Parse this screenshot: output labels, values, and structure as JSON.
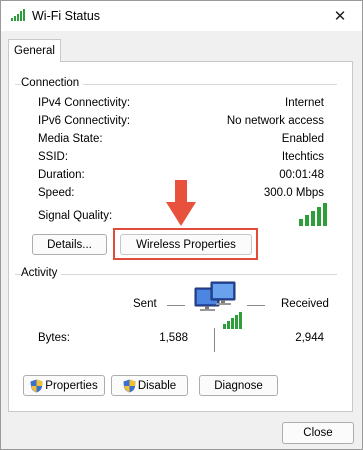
{
  "window": {
    "title": "Wi-Fi Status",
    "close_glyph": "✕"
  },
  "tabs": [
    {
      "label": "General"
    }
  ],
  "connection": {
    "heading": "Connection",
    "rows": [
      {
        "label": "IPv4 Connectivity:",
        "value": "Internet"
      },
      {
        "label": "IPv6 Connectivity:",
        "value": "No network access"
      },
      {
        "label": "Media State:",
        "value": "Enabled"
      },
      {
        "label": "SSID:",
        "value": "Itechtics"
      },
      {
        "label": "Duration:",
        "value": "00:01:48"
      },
      {
        "label": "Speed:",
        "value": "300.0 Mbps"
      }
    ],
    "signal_label": "Signal Quality:",
    "signal_bars": 5,
    "details_button": "Details...",
    "wireless_button": "Wireless Properties"
  },
  "activity": {
    "heading": "Activity",
    "sent_label": "Sent",
    "received_label": "Received",
    "bytes_label": "Bytes:",
    "bytes_sent": "1,588",
    "bytes_received": "2,944"
  },
  "actions": {
    "properties": "Properties",
    "disable": "Disable",
    "diagnose": "Diagnose",
    "close": "Close"
  },
  "colors": {
    "signal_green": "#2e9e3a",
    "highlight": "#e04b3a",
    "arrow": "#e8513b"
  }
}
